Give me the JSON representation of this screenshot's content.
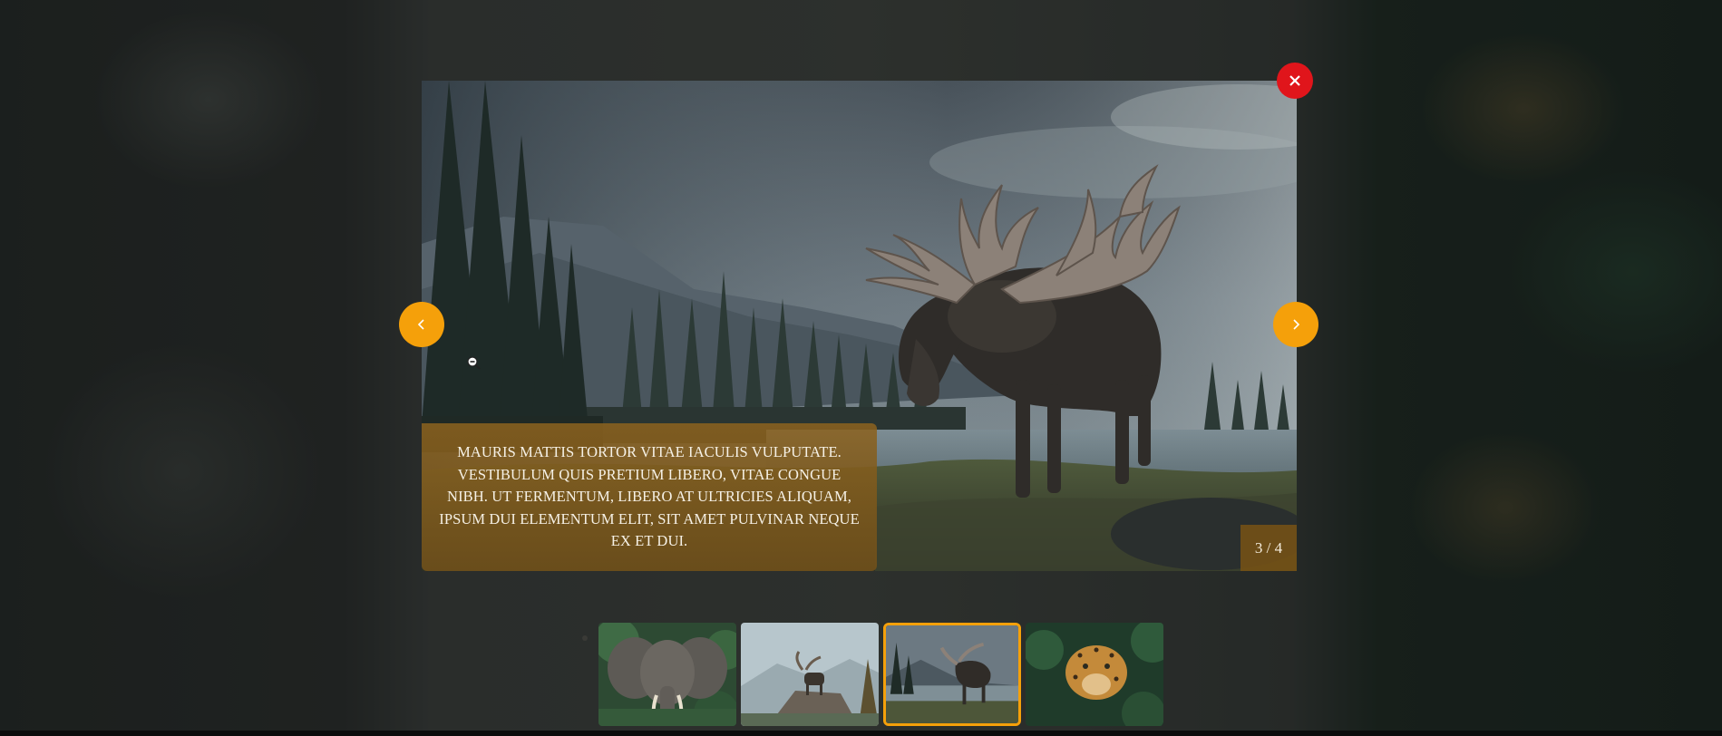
{
  "lightbox": {
    "caption": "MAURIS MATTIS TORTOR VITAE IACULIS VULPUTATE. VESTIBULUM QUIS PRETIUM LIBERO, VITAE CONGUE NIBH. UT FERMENTUM, LIBERO AT ULTRICIES ALIQUAM, IPSUM DUI ELEMENTUM ELIT, SIT AMET PULVINAR NEQUE EX ET DUI.",
    "counter": "3 / 4",
    "current_index": 3,
    "total": 4,
    "main_image_subject": "moose",
    "close_icon": "close-icon",
    "prev_icon": "chevron-left-icon",
    "next_icon": "chevron-right-icon"
  },
  "thumbnails": [
    {
      "subject": "elephant",
      "active": false
    },
    {
      "subject": "moose-on-rock",
      "active": false
    },
    {
      "subject": "moose",
      "active": true
    },
    {
      "subject": "leopard",
      "active": false
    }
  ],
  "colors": {
    "accent": "#f5a00a",
    "close": "#e0151b",
    "caption_bg": "#8c621e"
  }
}
